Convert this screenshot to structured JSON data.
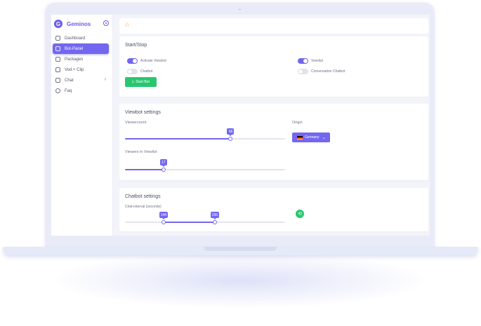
{
  "colors": {
    "accent": "#7367f0",
    "success": "#28c76f",
    "star": "#ff9f43"
  },
  "sidebar": {
    "brand": "Geminos",
    "logo_letter": "G",
    "items": [
      {
        "label": "Dashboard",
        "icon": "chat-square-icon",
        "active": false
      },
      {
        "label": "Bot-Panel",
        "icon": "monitor-icon",
        "active": true
      },
      {
        "label": "Packages",
        "icon": "cart-icon",
        "active": false
      },
      {
        "label": "Vod + Clip",
        "icon": "copy-icon",
        "active": false
      },
      {
        "label": "Chat",
        "icon": "chat-bubble-icon",
        "active": false,
        "has_submenu": true
      },
      {
        "label": "Faq",
        "icon": "settings-icon",
        "active": false
      }
    ]
  },
  "topbar": {
    "icon": "star-icon"
  },
  "start_stop": {
    "title": "Start/Stop",
    "toggles": [
      {
        "label": "Activate Viewbot",
        "on": true
      },
      {
        "label": "Viewlist",
        "on": true
      },
      {
        "label": "Chatbot",
        "on": false
      },
      {
        "label": "Conversation Chatbot",
        "on": false
      }
    ],
    "start_button": "▷ Start Bot"
  },
  "viewbot": {
    "title": "Viewbot settings",
    "viewercount": {
      "label": "Viewercount",
      "value": 68,
      "fraction": 0.66
    },
    "viewers_in_viewlist": {
      "label": "Viewers in Viewlist",
      "value": 17,
      "fraction": 0.24
    },
    "origin": {
      "label": "Origin",
      "selected": "Germany",
      "flag": "germany-flag-icon"
    }
  },
  "chatbot": {
    "title": "Chatbot settings",
    "interval": {
      "label": "Chat-interval (seconds)",
      "min_value": 144,
      "max_value": 335,
      "min_fraction": 0.24,
      "max_fraction": 0.56
    },
    "refresh_icon": "refresh-icon"
  }
}
